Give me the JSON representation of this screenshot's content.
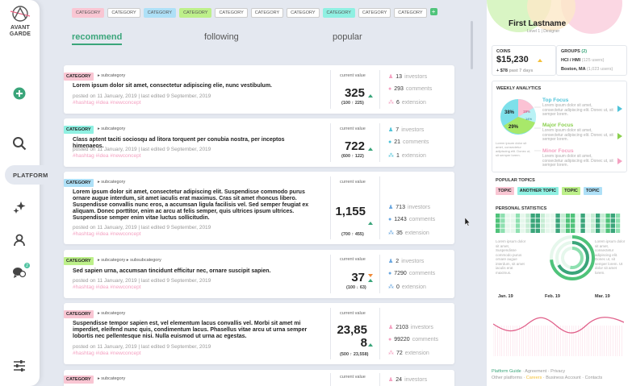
{
  "app": {
    "logo_text": "AVANT GARDE"
  },
  "sidebar": {
    "platform_label": "PLATFORM",
    "notif_count": "2"
  },
  "categories": [
    {
      "label": "CATEGORY",
      "color": "pink"
    },
    {
      "label": "CATEGORY",
      "color": "white"
    },
    {
      "label": "CATEGORY",
      "color": "blue"
    },
    {
      "label": "CATEGORY",
      "color": "green"
    },
    {
      "label": "CATEGORY",
      "color": "white"
    },
    {
      "label": "CATEGORY",
      "color": "white"
    },
    {
      "label": "CATEGORY",
      "color": "white"
    },
    {
      "label": "CATEGORY",
      "color": "teal"
    },
    {
      "label": "CATEGORY",
      "color": "white"
    },
    {
      "label": "CATEGORY",
      "color": "white"
    }
  ],
  "feed_tabs": {
    "recommend": "recommend",
    "following": "following",
    "popular": "popular"
  },
  "posts": [
    {
      "tag": "CATEGORY",
      "crumb": "subcategory",
      "title": "Lorem ipsum dolor sit amet, consectetur adipiscing elie, nunc vestibulum.",
      "meta": "posted on 11 January, 2019 | last edited 9 September, 2019",
      "tags": "#hashtag #idea #newconcept",
      "cv_label": "current value",
      "cv": "325",
      "cv_sub": "(100 ↑ 225)",
      "investors": "13",
      "investors_l": "investors",
      "comments": "293",
      "comments_l": "comments",
      "ext": "6",
      "ext_l": "extension"
    },
    {
      "tag": "CATEGORY",
      "crumb": "subcategory",
      "title": "Class aptent taciti sociosqu ad litora torquent per conubia nostra, per inceptos himenaeos.",
      "meta": "posted on 11 January, 2019 | last edited 9 September, 2019",
      "tags": "#hashtag #idea #newconcept",
      "cv_label": "current value",
      "cv": "722",
      "cv_sub": "(600 ↑ 122)",
      "investors": "7",
      "investors_l": "investors",
      "comments": "21",
      "comments_l": "comments",
      "ext": "1",
      "ext_l": "extension"
    },
    {
      "tag": "CATEGORY",
      "crumb": "subcategory",
      "title": "Lorem ipsum dolor sit amet, consectetur adipiscing elit. Suspendisse commodo purus ornare augue interdum, sit amet iaculis erat maximus. Cras sit amet rhoncus libero. Suspendisse convallis nunc eros, a accumsan ligula facilisis vel. Sed semper feugiat ex aliquam. Donec porttitor, enim ac arcu at felis semper, quis ultrices ipsum ultrices. Suspendisse semper enim vitae luctus sollicitudin.",
      "meta": "posted on 11 January, 2019 | last edited 9 September, 2019",
      "tags": "#hashtag #idea #newconcept",
      "cv_label": "current value",
      "cv": "1,155",
      "cv_sub": "(700 ↑ 455)",
      "investors": "713",
      "investors_l": "investors",
      "comments": "1243",
      "comments_l": "comments",
      "ext": "35",
      "ext_l": "extension"
    },
    {
      "tag": "CATEGORY",
      "crumb": "subcategory",
      "crumb2": "subsubcategory",
      "title": "Sed sapien urna, accumsan tincidunt efficitur nec, ornare suscipit sapien.",
      "meta": "posted on 11 January, 2019 | last edited 9 September, 2019",
      "tags": "#hashtag #idea #newconcept",
      "cv_label": "current value",
      "cv": "37",
      "cv_sub": "(100 ↓ 63)",
      "investors": "2",
      "investors_l": "investors",
      "comments": "7290",
      "comments_l": "comments",
      "ext": "0",
      "ext_l": "extension"
    },
    {
      "tag": "CATEGORY",
      "crumb": "subcategory",
      "title": "Suspendisse tempor sapien est, vel elementum lacus convallis vel. Morbi sit amet mi imperdiet, eleifend nunc quis, condimentum lacus. Phasellus vitae arcu ut urna semper lobortis nec pellentesque nisi. Nulla euismod ut urna ac egestas.",
      "meta": "posted on 11 January, 2019 | last edited 9 September, 2019",
      "tags": "#hashtag #idea #newconcept",
      "cv_label": "current value",
      "cv": "23,858",
      "cv_sub": "(500 ↑ 23,558)",
      "investors": "2103",
      "investors_l": "investors",
      "comments": "99220",
      "comments_l": "comments",
      "ext": "72",
      "ext_l": "extension"
    },
    {
      "tag": "CATEGORY",
      "crumb": "subcategory",
      "cv_label": "current value",
      "investors": "24",
      "investors_l": "investors"
    }
  ],
  "profile": {
    "name": "First Lastname",
    "role": "Level 1 | Designer",
    "coins_label": "COINS",
    "coins": "$15,230",
    "coins_sub": "+ $78",
    "coins_sub2": "past 7 days",
    "groups_label": "GROUPS",
    "groups_count": "(2)",
    "group1": "HCI / HMI",
    "group1_sub": "(125 users)",
    "group2": "Boston, MA",
    "group2_sub": "(1,023 users)"
  },
  "weekly": {
    "title": "WEEKLY ANALYTICS",
    "p1": "38%",
    "p2": "29%",
    "p3": "19%",
    "p4": "14%",
    "focus1": "Top Focus",
    "focus2": "Major Focus",
    "focus3": "Minor Focus",
    "lorem": "Lorem ipsum dolor sit amet, consectetur adipiscing elit. Donec ut, sit semper lorem.",
    "side_note": "Lorem ipsum dolor sit amet, consectetur adipiscing elit. Donec ut, sit semper lorem."
  },
  "topics": {
    "title": "POPULAR TOPICS",
    "items": [
      "TOPIC",
      "ANOTHER TOPIC",
      "TOPIC",
      "TOPIC"
    ]
  },
  "personal": {
    "title": "PERSONAL STATISTICS",
    "left_text": "Lorem ipsum dolor sit amet, Suspendisse commodo purus ornare augue interdum, sit amet iaculis erat maximus.",
    "right_text": "Lorem ipsum dolor sit amet, consectetur adipiscing elit. Donec ut, sit semper lorem. Ut dolor sit amet lorem.",
    "dates": [
      "Jan. 19",
      "Feb. 19",
      "Mar. 19"
    ]
  },
  "footer": {
    "line1": [
      "Platform Guide",
      "Agreement",
      "Privacy"
    ],
    "line2": [
      "Other platforms",
      "Careers",
      "Business Account",
      "Contacts"
    ]
  }
}
